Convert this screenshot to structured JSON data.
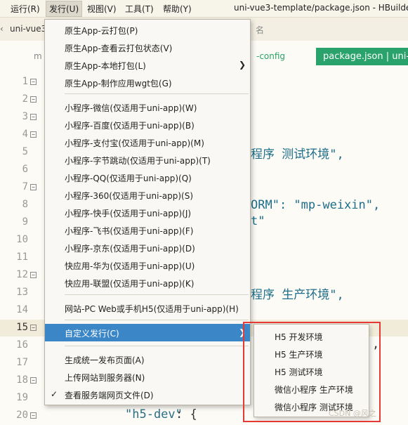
{
  "menubar": {
    "items": [
      {
        "label": "运行(R)"
      },
      {
        "label": "发行(U)"
      },
      {
        "label": "视图(V)"
      },
      {
        "label": "工具(T)"
      },
      {
        "label": "帮助(Y)"
      }
    ],
    "window_title": "uni-vue3-template/package.json - HBuilder"
  },
  "tabbar": {
    "tab1": "uni-vue3",
    "tab2": "名"
  },
  "editor_header": {
    "crumb_left": "m",
    "crumb_mid": "-config",
    "tag": "package.json | uni-v"
  },
  "gutter": {
    "lines": [
      "1",
      "2",
      "3",
      "4",
      "5",
      "6",
      "7",
      "8",
      "9",
      "10",
      "11",
      "12",
      "13",
      "14",
      "15",
      "16",
      "17",
      "18",
      "19",
      "20"
    ]
  },
  "code": {
    "l5": "程序 测试环境\",",
    "l8": "ORM\": \"mp-weixin\",",
    "l9": "t\"",
    "l13": "程序 生产环境\",",
    "l16": ",",
    "l20_key": "\"h5-dev\"",
    "l20_rest": ": {"
  },
  "dropdown": {
    "items": [
      {
        "label": "原生App-云打包(P)"
      },
      {
        "label": "原生App-查看云打包状态(V)"
      },
      {
        "label": "原生App-本地打包(L)"
      },
      {
        "label": "原生App-制作应用wgt包(G)"
      },
      {
        "label": "小程序-微信(仅适用于uni-app)(W)"
      },
      {
        "label": "小程序-百度(仅适用于uni-app)(B)"
      },
      {
        "label": "小程序-支付宝(仅适用于uni-app)(M)"
      },
      {
        "label": "小程序-字节跳动(仅适用于uni-app)(T)"
      },
      {
        "label": "小程序-QQ(仅适用于uni-app)(Q)"
      },
      {
        "label": "小程序-360(仅适用于uni-app)(S)"
      },
      {
        "label": "小程序-快手(仅适用于uni-app)(J)"
      },
      {
        "label": "小程序-飞书(仅适用于uni-app)(F)"
      },
      {
        "label": "小程序-京东(仅适用于uni-app)(D)"
      },
      {
        "label": "快应用-华为(仅适用于uni-app)(U)"
      },
      {
        "label": "快应用-联盟(仅适用于uni-app)(K)"
      },
      {
        "label": "网站-PC Web或手机H5(仅适用于uni-app)(H)"
      },
      {
        "label": "自定义发行(C)"
      },
      {
        "label": "生成统一发布页面(A)"
      },
      {
        "label": "上传网站到服务器(N)"
      },
      {
        "label": "查看服务端网页文件(D)"
      }
    ]
  },
  "submenu": {
    "items": [
      {
        "label": "H5 开发环境"
      },
      {
        "label": "H5 生产环境"
      },
      {
        "label": "H5 测试环境"
      },
      {
        "label": "微信小程序 生产环境"
      },
      {
        "label": "微信小程序 测试环境"
      }
    ]
  },
  "watermark": "CSDN @风之"
}
